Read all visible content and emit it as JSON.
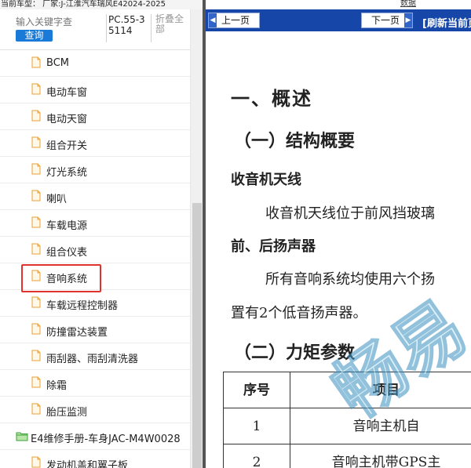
{
  "model_bar": "当前车型： 厂家:J-江淮汽车瑞风E42024-2025",
  "top_right_link": "数据",
  "search": {
    "placeholder": "输入关键字查",
    "button": "查询"
  },
  "model_code": "PC.55-35114",
  "collapse_all": "折叠全部",
  "tree_items": [
    "BCM",
    "电动车窗",
    "电动天窗",
    "组合开关",
    "灯光系统",
    "喇叭",
    "车载电源",
    "组合仪表",
    "音响系统",
    "车载远程控制器",
    "防撞雷达装置",
    "雨刮器、雨刮清洗器",
    "除霜",
    "胎压监测"
  ],
  "tree_folder": "E4维修手册-车身JAC-M4W0028",
  "tree_item_after": "发动机盖和翼子板",
  "nav": {
    "prev": "上一页",
    "next": "下一页",
    "refresh": "[刷新当前页"
  },
  "doc": {
    "h1": "一、概述",
    "section1": "（一）结构概要",
    "sub1": "收音机天线",
    "para1": "收音机天线位于前风挡玻璃",
    "sub2": "前、后扬声器",
    "para2a": "所有音响系统均使用六个扬",
    "para2b": "置有2个低音扬声器。",
    "section2": "（二）力矩参数",
    "table": {
      "headers": [
        "序号",
        "项目"
      ],
      "rows": [
        [
          "1",
          "音响主机自"
        ],
        [
          "2",
          "音响主机带GPS主"
        ]
      ]
    }
  },
  "watermark": "畅易",
  "colors": {
    "nav_bar": "#1546a8",
    "search_button": "#1a7ad8",
    "highlight": "#e0332e",
    "folder": "#3aa33a",
    "doc_icon": "#e8a030"
  }
}
